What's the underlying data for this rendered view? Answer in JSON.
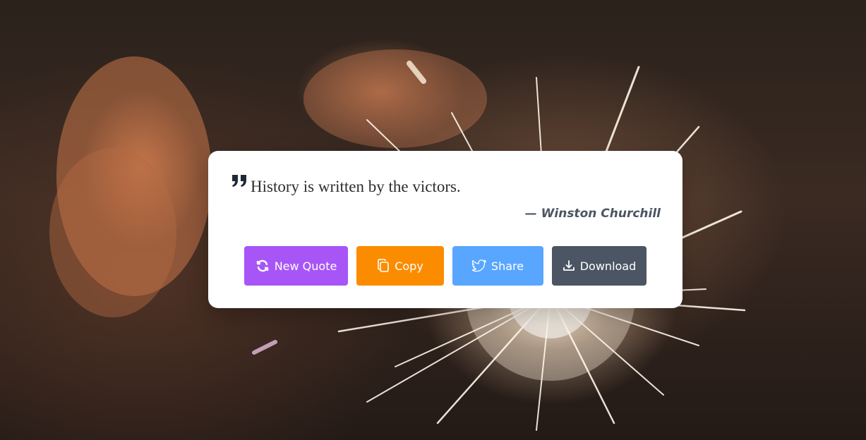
{
  "quote": {
    "text": "History is written by the victors.",
    "author": "— Winston Churchill"
  },
  "buttons": {
    "new_quote": {
      "label": "New Quote",
      "icon": "refresh-icon",
      "color": "#a855f7"
    },
    "copy": {
      "label": "Copy",
      "icon": "copy-icon",
      "color": "#fb8c00"
    },
    "share": {
      "label": "Share",
      "icon": "twitter-icon",
      "color": "#58a6ff"
    },
    "download": {
      "label": "Download",
      "icon": "download-icon",
      "color": "#4b5563"
    }
  },
  "background": {
    "description_icon": "sparkler-photo"
  }
}
